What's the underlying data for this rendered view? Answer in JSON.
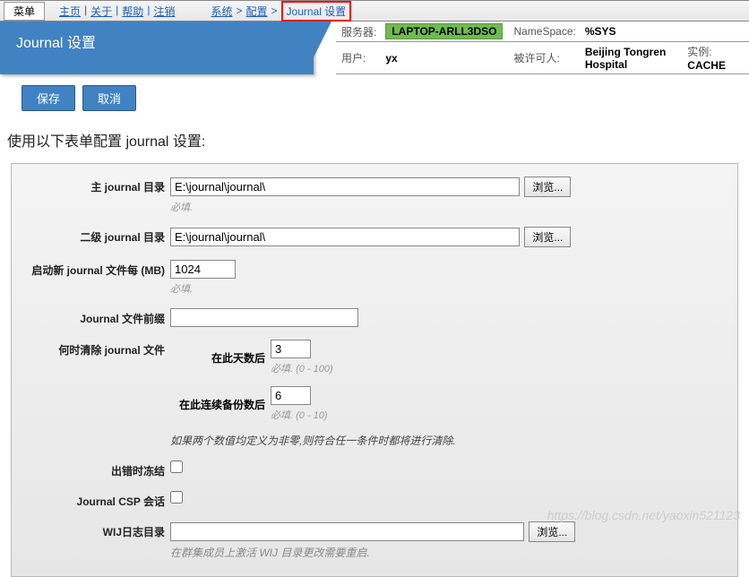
{
  "menu": {
    "button": "菜单"
  },
  "nav": {
    "home": "主页",
    "about": "关于",
    "help": "帮助",
    "logout": "注销"
  },
  "breadcrumb": {
    "l1": "系统",
    "l2": "配置",
    "current": "Journal 设置"
  },
  "title": "Journal 设置",
  "info": {
    "server_label": "服务器:",
    "server": "LAPTOP-ARLL3DSO",
    "ns_label": "NameSpace:",
    "ns": "%SYS",
    "user_label": "用户:",
    "user": "yx",
    "lic_label": "被许可人:",
    "lic": "Beijing Tongren Hospital",
    "inst_label": "实例:",
    "inst": "CACHE"
  },
  "actions": {
    "save": "保存",
    "cancel": "取消"
  },
  "instructions": "使用以下表单配置 journal 设置:",
  "form": {
    "primary_label": "主 journal 目录",
    "primary_value": "E:\\journal\\journal\\",
    "required": "必填.",
    "secondary_label": "二级 journal 目录",
    "secondary_value": "E:\\journal\\journal\\",
    "newfile_label": "启动新 journal 文件每 (MB)",
    "newfile_value": "1024",
    "prefix_label": "Journal 文件前缀",
    "prefix_value": "",
    "purge_label": "何时清除 journal 文件",
    "days_label": "在此天数后",
    "days_value": "3",
    "days_hint": "必填. (0 - 100)",
    "backups_label": "在此连续备份数后",
    "backups_value": "6",
    "backups_hint": "必填. (0 - 10)",
    "purge_note": "如果两个数值均定义为非零,则符合任一条件时都将进行清除.",
    "freeze_label": "出错时冻结",
    "csp_label": "Journal CSP 会话",
    "wij_label": "WIJ日志目录",
    "wij_value": "",
    "wij_hint": "在群集成员上激活 WIJ 目录更改需要重启.",
    "browse": "浏览..."
  },
  "watermark": "https://blog.csdn.net/yaoxin521123"
}
